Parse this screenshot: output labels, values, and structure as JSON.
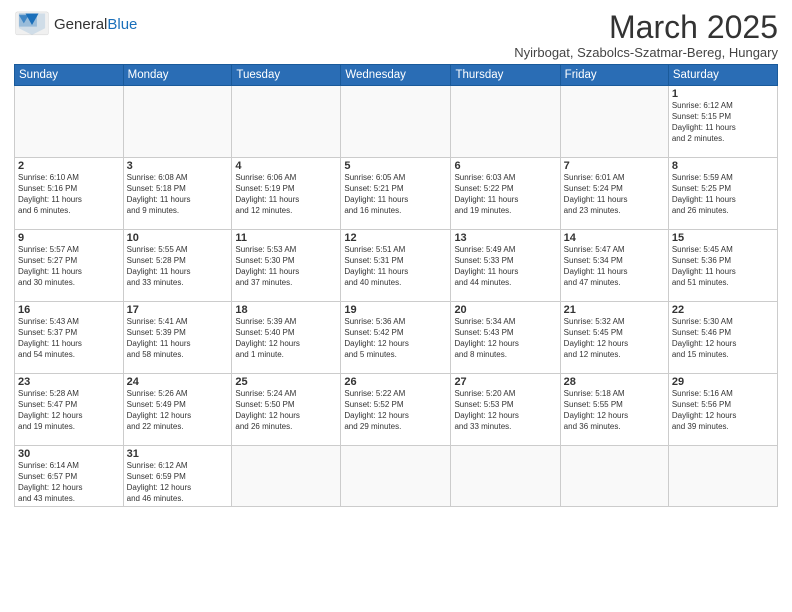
{
  "header": {
    "logo_general": "General",
    "logo_blue": "Blue",
    "month": "March 2025",
    "location": "Nyirbogat, Szabolcs-Szatmar-Bereg, Hungary"
  },
  "weekdays": [
    "Sunday",
    "Monday",
    "Tuesday",
    "Wednesday",
    "Thursday",
    "Friday",
    "Saturday"
  ],
  "weeks": [
    [
      {
        "day": "",
        "info": ""
      },
      {
        "day": "",
        "info": ""
      },
      {
        "day": "",
        "info": ""
      },
      {
        "day": "",
        "info": ""
      },
      {
        "day": "",
        "info": ""
      },
      {
        "day": "",
        "info": ""
      },
      {
        "day": "1",
        "info": "Sunrise: 6:12 AM\nSunset: 5:15 PM\nDaylight: 11 hours\nand 2 minutes."
      }
    ],
    [
      {
        "day": "2",
        "info": "Sunrise: 6:10 AM\nSunset: 5:16 PM\nDaylight: 11 hours\nand 6 minutes."
      },
      {
        "day": "3",
        "info": "Sunrise: 6:08 AM\nSunset: 5:18 PM\nDaylight: 11 hours\nand 9 minutes."
      },
      {
        "day": "4",
        "info": "Sunrise: 6:06 AM\nSunset: 5:19 PM\nDaylight: 11 hours\nand 12 minutes."
      },
      {
        "day": "5",
        "info": "Sunrise: 6:05 AM\nSunset: 5:21 PM\nDaylight: 11 hours\nand 16 minutes."
      },
      {
        "day": "6",
        "info": "Sunrise: 6:03 AM\nSunset: 5:22 PM\nDaylight: 11 hours\nand 19 minutes."
      },
      {
        "day": "7",
        "info": "Sunrise: 6:01 AM\nSunset: 5:24 PM\nDaylight: 11 hours\nand 23 minutes."
      },
      {
        "day": "8",
        "info": "Sunrise: 5:59 AM\nSunset: 5:25 PM\nDaylight: 11 hours\nand 26 minutes."
      }
    ],
    [
      {
        "day": "9",
        "info": "Sunrise: 5:57 AM\nSunset: 5:27 PM\nDaylight: 11 hours\nand 30 minutes."
      },
      {
        "day": "10",
        "info": "Sunrise: 5:55 AM\nSunset: 5:28 PM\nDaylight: 11 hours\nand 33 minutes."
      },
      {
        "day": "11",
        "info": "Sunrise: 5:53 AM\nSunset: 5:30 PM\nDaylight: 11 hours\nand 37 minutes."
      },
      {
        "day": "12",
        "info": "Sunrise: 5:51 AM\nSunset: 5:31 PM\nDaylight: 11 hours\nand 40 minutes."
      },
      {
        "day": "13",
        "info": "Sunrise: 5:49 AM\nSunset: 5:33 PM\nDaylight: 11 hours\nand 44 minutes."
      },
      {
        "day": "14",
        "info": "Sunrise: 5:47 AM\nSunset: 5:34 PM\nDaylight: 11 hours\nand 47 minutes."
      },
      {
        "day": "15",
        "info": "Sunrise: 5:45 AM\nSunset: 5:36 PM\nDaylight: 11 hours\nand 51 minutes."
      }
    ],
    [
      {
        "day": "16",
        "info": "Sunrise: 5:43 AM\nSunset: 5:37 PM\nDaylight: 11 hours\nand 54 minutes."
      },
      {
        "day": "17",
        "info": "Sunrise: 5:41 AM\nSunset: 5:39 PM\nDaylight: 11 hours\nand 58 minutes."
      },
      {
        "day": "18",
        "info": "Sunrise: 5:39 AM\nSunset: 5:40 PM\nDaylight: 12 hours\nand 1 minute."
      },
      {
        "day": "19",
        "info": "Sunrise: 5:36 AM\nSunset: 5:42 PM\nDaylight: 12 hours\nand 5 minutes."
      },
      {
        "day": "20",
        "info": "Sunrise: 5:34 AM\nSunset: 5:43 PM\nDaylight: 12 hours\nand 8 minutes."
      },
      {
        "day": "21",
        "info": "Sunrise: 5:32 AM\nSunset: 5:45 PM\nDaylight: 12 hours\nand 12 minutes."
      },
      {
        "day": "22",
        "info": "Sunrise: 5:30 AM\nSunset: 5:46 PM\nDaylight: 12 hours\nand 15 minutes."
      }
    ],
    [
      {
        "day": "23",
        "info": "Sunrise: 5:28 AM\nSunset: 5:47 PM\nDaylight: 12 hours\nand 19 minutes."
      },
      {
        "day": "24",
        "info": "Sunrise: 5:26 AM\nSunset: 5:49 PM\nDaylight: 12 hours\nand 22 minutes."
      },
      {
        "day": "25",
        "info": "Sunrise: 5:24 AM\nSunset: 5:50 PM\nDaylight: 12 hours\nand 26 minutes."
      },
      {
        "day": "26",
        "info": "Sunrise: 5:22 AM\nSunset: 5:52 PM\nDaylight: 12 hours\nand 29 minutes."
      },
      {
        "day": "27",
        "info": "Sunrise: 5:20 AM\nSunset: 5:53 PM\nDaylight: 12 hours\nand 33 minutes."
      },
      {
        "day": "28",
        "info": "Sunrise: 5:18 AM\nSunset: 5:55 PM\nDaylight: 12 hours\nand 36 minutes."
      },
      {
        "day": "29",
        "info": "Sunrise: 5:16 AM\nSunset: 5:56 PM\nDaylight: 12 hours\nand 39 minutes."
      }
    ],
    [
      {
        "day": "30",
        "info": "Sunrise: 6:14 AM\nSunset: 6:57 PM\nDaylight: 12 hours\nand 43 minutes."
      },
      {
        "day": "31",
        "info": "Sunrise: 6:12 AM\nSunset: 6:59 PM\nDaylight: 12 hours\nand 46 minutes."
      },
      {
        "day": "",
        "info": ""
      },
      {
        "day": "",
        "info": ""
      },
      {
        "day": "",
        "info": ""
      },
      {
        "day": "",
        "info": ""
      },
      {
        "day": "",
        "info": ""
      }
    ]
  ]
}
